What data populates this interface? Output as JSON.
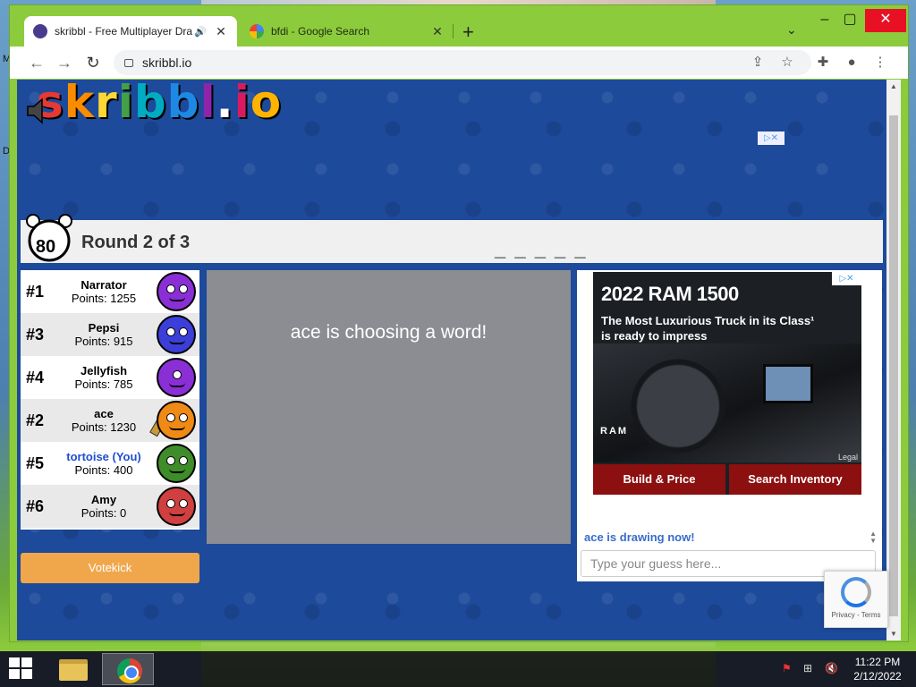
{
  "browser": {
    "tabs": [
      {
        "title": "skribbl - Free Multiplayer Dra",
        "close": "✕"
      },
      {
        "title": "bfdi - Google Search",
        "close": "✕"
      }
    ],
    "new_tab": "+",
    "url": "skribbl.io"
  },
  "game": {
    "logo": "skribbl.io",
    "timer": "80",
    "round": "Round 2 of 3",
    "word_hint": "_ _ _ _ _",
    "players": [
      {
        "rank": "#1",
        "name": "Narrator",
        "points": "Points: 1255",
        "color": "#8a2fd6"
      },
      {
        "rank": "#3",
        "name": "Pepsi",
        "points": "Points: 915",
        "color": "#3b3fd8"
      },
      {
        "rank": "#4",
        "name": "Jellyfish",
        "points": "Points: 785",
        "color": "#8a2fd6"
      },
      {
        "rank": "#2",
        "name": "ace",
        "points": "Points: 1230",
        "color": "#f08a16"
      },
      {
        "rank": "#5",
        "name": "tortoise (You)",
        "points": "Points: 400",
        "color": "#3f8c2a"
      },
      {
        "rank": "#6",
        "name": "Amy",
        "points": "Points: 0",
        "color": "#d04040"
      }
    ],
    "votekick": "Votekick",
    "canvas_message": "ace is choosing a word!",
    "chat_message": "ace is drawing now!",
    "guess_placeholder": "Type your guess here..."
  },
  "ad": {
    "headline": "2022 RAM 1500",
    "subline": "The Most Luxurious Truck in its Class¹ is ready to impress",
    "brand": "RAM",
    "legal": "Legal",
    "button_left": "Build & Price",
    "button_right": "Search Inventory"
  },
  "recaptcha": {
    "privacy": "Privacy - Terms"
  },
  "taskbar": {
    "time": "11:22 PM",
    "date": "2/12/2022"
  }
}
